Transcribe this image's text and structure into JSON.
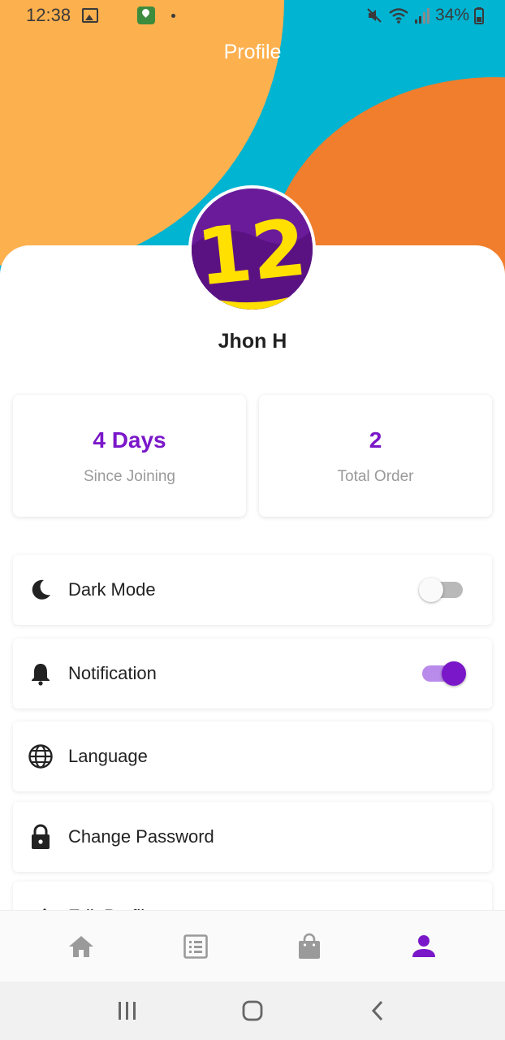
{
  "status_bar": {
    "time": "12:38",
    "battery": "34%"
  },
  "header": {
    "title": "Profile"
  },
  "profile": {
    "name": "Jhon H",
    "avatar_text": "12"
  },
  "stats": [
    {
      "value": "4 Days",
      "label": "Since Joining"
    },
    {
      "value": "2",
      "label": "Total Order"
    }
  ],
  "settings": [
    {
      "label": "Dark Mode",
      "icon": "moon-icon",
      "toggle": false
    },
    {
      "label": "Notification",
      "icon": "bell-icon",
      "toggle": true
    },
    {
      "label": "Language",
      "icon": "globe-icon"
    },
    {
      "label": "Change Password",
      "icon": "lock-icon"
    },
    {
      "label": "Edit Profile",
      "icon": "edit-icon"
    }
  ],
  "bottom_nav": [
    {
      "icon": "home-icon",
      "active": false
    },
    {
      "icon": "list-icon",
      "active": false
    },
    {
      "icon": "shopping-bag-icon",
      "active": false
    },
    {
      "icon": "person-icon",
      "active": true
    }
  ],
  "colors": {
    "accent": "#7a17c9",
    "header_blue": "#00b4d2",
    "header_yellow": "#fdb04e",
    "header_orange": "#f07e2c",
    "inactive_icon": "#9a9a9a",
    "toggle_on_track": "#b98bea",
    "toggle_off_track": "#b9b9b9"
  }
}
